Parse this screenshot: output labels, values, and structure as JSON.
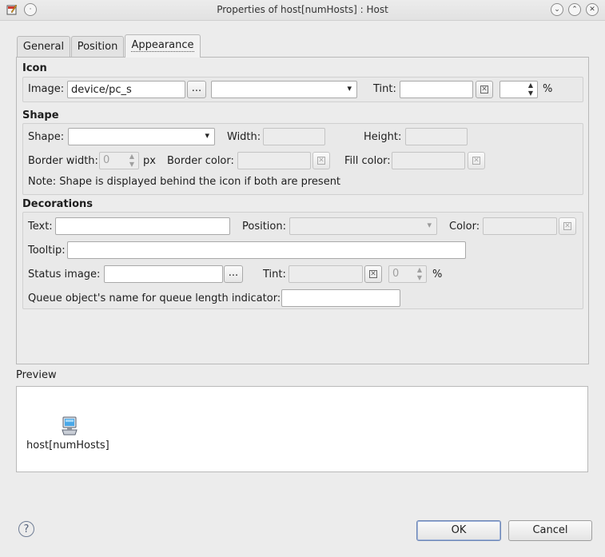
{
  "window": {
    "title": "Properties of host[numHosts] : Host"
  },
  "tabs": [
    {
      "label": "General"
    },
    {
      "label": "Position"
    },
    {
      "label": "Appearance"
    }
  ],
  "icon_section": {
    "title": "Icon",
    "image_label": "Image:",
    "image_value": "device/pc_s",
    "browse_label": "...",
    "tint_label": "Tint:",
    "percent": "%"
  },
  "shape_section": {
    "title": "Shape",
    "shape_label": "Shape:",
    "width_label": "Width:",
    "height_label": "Height:",
    "border_width_label": "Border width:",
    "border_width_value": "0",
    "px": "px",
    "border_color_label": "Border color:",
    "fill_color_label": "Fill color:",
    "note": "Note: Shape is displayed behind the icon if both are present"
  },
  "decorations_section": {
    "title": "Decorations",
    "text_label": "Text:",
    "position_label": "Position:",
    "color_label": "Color:",
    "tooltip_label": "Tooltip:",
    "status_image_label": "Status image:",
    "browse_label": "...",
    "tint_label": "Tint:",
    "tint_value": "0",
    "percent": "%",
    "queue_label": "Queue object's name for queue length indicator:"
  },
  "preview": {
    "title": "Preview",
    "node_label": "host[numHosts]"
  },
  "buttons": {
    "help": "?",
    "ok": "OK",
    "cancel": "Cancel"
  }
}
